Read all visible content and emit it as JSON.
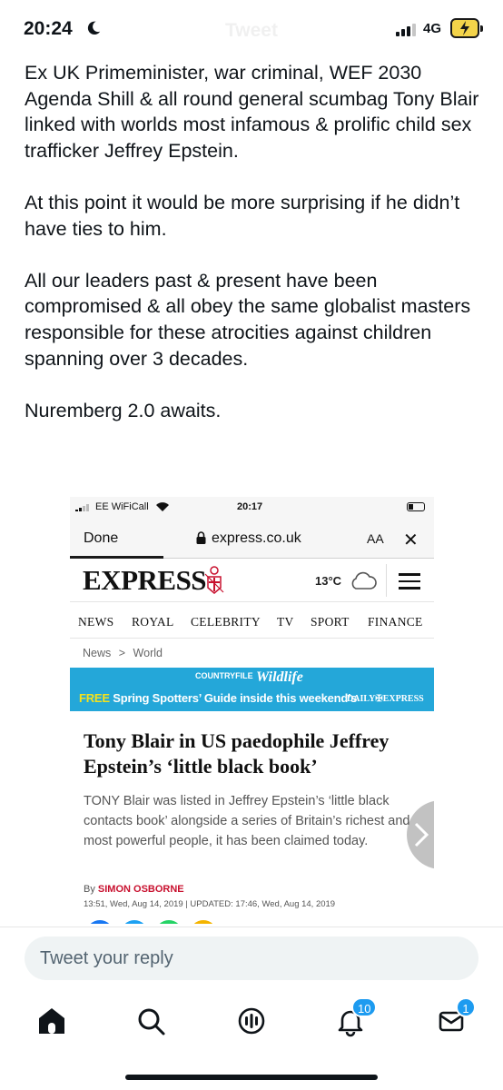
{
  "status_bar": {
    "time": "20:24",
    "title": "Tweet",
    "network": "4G"
  },
  "tweet": {
    "paragraphs": [
      "Ex UK Primeminister, war criminal, WEF 2030 Agenda Shill & all round general scumbag Tony Blair linked with worlds most infamous & prolific child sex trafficker Jeffrey Epstein.",
      "At this point it would be more surprising if he didn’t have ties to him.",
      "All our leaders past & present have been compromised & all obey the same globalist masters responsible for these atrocities against children spanning over 3 decades.",
      "Nuremberg 2.0 awaits."
    ]
  },
  "embedded": {
    "status": {
      "carrier": "EE WiFiCall",
      "time": "20:17"
    },
    "browser": {
      "done_label": "Done",
      "url": "express.co.uk",
      "text_size_label": "AA",
      "close_label": "✕"
    },
    "masthead": {
      "logo": "EXPRESS",
      "temperature": "13°C"
    },
    "sections": [
      "NEWS",
      "ROYAL",
      "CELEBRITY",
      "TV",
      "SPORT",
      "FINANCE"
    ],
    "breadcrumb": {
      "first": "News",
      "separator": ">",
      "second": "World"
    },
    "banner": {
      "top_left": "COUNTRYFILE",
      "top_right": "Wildlife",
      "free": "FREE",
      "line": " Spring Spotters’ Guide inside this weekend’s",
      "paper": "DAILY✠EXPRESS"
    },
    "article": {
      "headline": "Tony Blair in US paedophile Jeffrey Epstein’s ‘little black book’",
      "standfirst": "TONY Blair was listed in Jeffrey Epstein’s ‘little black contacts book’ alongside a series of Britain’s richest and most powerful people, it has been claimed today.",
      "byline_prefix": "By ",
      "author": "SIMON OSBORNE",
      "dateline": "13:51, Wed, Aug 14, 2019 | UPDATED: 17:46, Wed, Aug 14, 2019"
    }
  },
  "reply": {
    "placeholder": "Tweet your reply"
  },
  "tabbar": {
    "notifications_badge": "10",
    "messages_badge": "1"
  },
  "colors": {
    "accent": "#1d9bf0",
    "express_red": "#c8102e",
    "banner_blue": "#24a7d9"
  }
}
